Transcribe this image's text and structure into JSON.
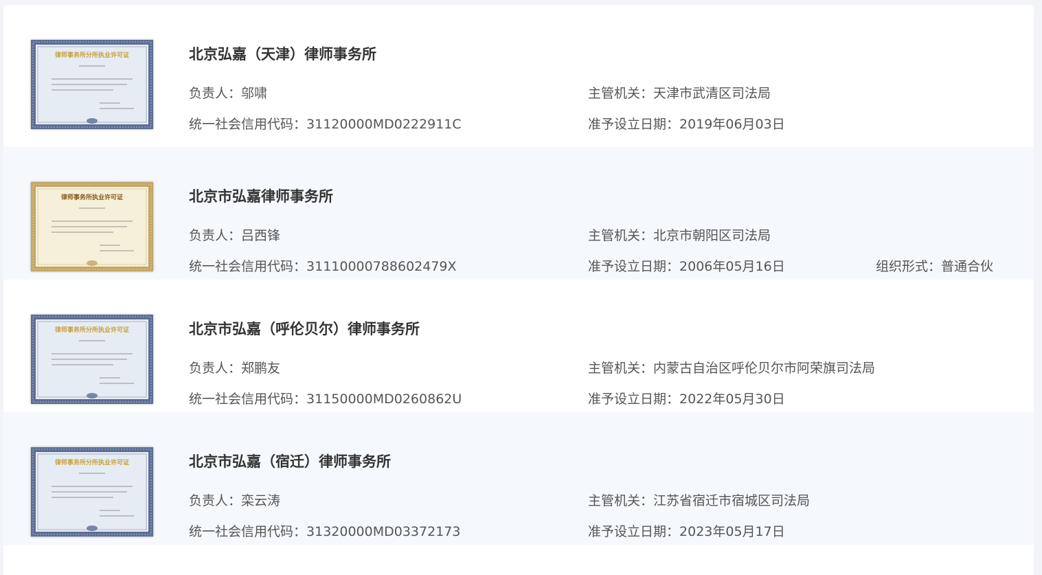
{
  "labels": {
    "head": "负责人：",
    "authority": "主管机关：",
    "credit_code": "统一社会信用代码：",
    "approval_date": "准予设立日期：",
    "org_form": "组织形式："
  },
  "firms": [
    {
      "name": "北京弘嘉（天津）律师事务所",
      "head": "邬啸",
      "authority": "天津市武清区司法局",
      "credit_code": "31120000MD0222911C",
      "approval_date": "2019年06月03日",
      "org_form": null,
      "license": {
        "title": "律师事务所分所执业许可证",
        "theme": "blue",
        "frame_color": "#5d6d95",
        "paper_color": "#e6ecf3",
        "title_color": "#c9a23c"
      }
    },
    {
      "name": "北京市弘嘉律师事务所",
      "head": "吕西锋",
      "authority": "北京市朝阳区司法局",
      "credit_code": "31110000788602479X",
      "approval_date": "2006年05月16日",
      "org_form": "普通合伙",
      "license": {
        "title": "律师事务所执业许可证",
        "theme": "gold",
        "frame_color": "#c4a564",
        "paper_color": "#f6f0da",
        "title_color": "#8a5a1a"
      }
    },
    {
      "name": "北京市弘嘉（呼伦贝尔）律师事务所",
      "head": "郑鹏友",
      "authority": "内蒙古自治区呼伦贝尔市阿荣旗司法局",
      "credit_code": "31150000MD0260862U",
      "approval_date": "2022年05月30日",
      "org_form": null,
      "license": {
        "title": "律师事务所分所执业许可证",
        "theme": "blue",
        "frame_color": "#5d6d95",
        "paper_color": "#e6ecf3",
        "title_color": "#c9a23c"
      }
    },
    {
      "name": "北京市弘嘉（宿迁）律师事务所",
      "head": "栾云涛",
      "authority": "江苏省宿迁市宿城区司法局",
      "credit_code": "31320000MD03372173",
      "approval_date": "2023年05月17日",
      "org_form": null,
      "license": {
        "title": "律师事务所分所执业许可证",
        "theme": "blue",
        "frame_color": "#5d6d95",
        "paper_color": "#e6ecf3",
        "title_color": "#c9a23c"
      }
    }
  ]
}
